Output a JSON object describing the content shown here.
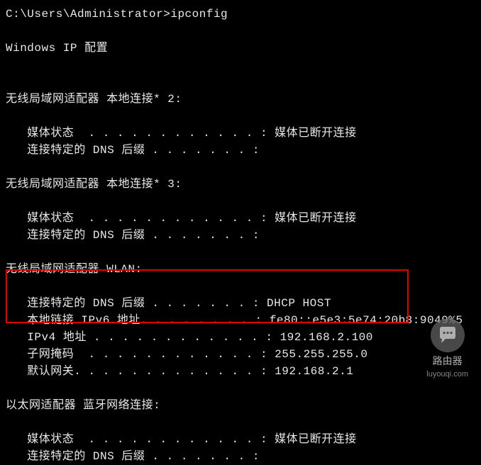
{
  "prompt": "C:\\Users\\Administrator>ipconfig",
  "header": "Windows IP 配置",
  "adapters": {
    "wlan2": {
      "title": "无线局域网适配器 本地连接* 2:",
      "media_state_label": "   媒体状态  . . . . . . . . . . . . : ",
      "media_state_value": "媒体已断开连接",
      "dns_suffix_label": "   连接特定的 DNS 后缀 . . . . . . . :"
    },
    "wlan3": {
      "title": "无线局域网适配器 本地连接* 3:",
      "media_state_label": "   媒体状态  . . . . . . . . . . . . : ",
      "media_state_value": "媒体已断开连接",
      "dns_suffix_label": "   连接特定的 DNS 后缀 . . . . . . . :"
    },
    "wlan": {
      "title": "无线局域网适配器 WLAN:",
      "dns_suffix_label": "   连接特定的 DNS 后缀 . . . . . . . : ",
      "dns_suffix_value": "DHCP HOST",
      "ipv6_label": "   本地链接 IPv6 地址. . . . . . . . : ",
      "ipv6_value": "fe80::e5e3:5e74:20b8:9049%5",
      "ipv4_label": "   IPv4 地址 . . . . . . . . . . . . : ",
      "ipv4_value": "192.168.2.100",
      "subnet_label": "   子网掩码  . . . . . . . . . . . . : ",
      "subnet_value": "255.255.255.0",
      "gateway_label": "   默认网关. . . . . . . . . . . . . : ",
      "gateway_value": "192.168.2.1"
    },
    "bluetooth": {
      "title": "以太网适配器 蓝牙网络连接:",
      "media_state_label": "   媒体状态  . . . . . . . . . . . . : ",
      "media_state_value": "媒体已断开连接",
      "dns_suffix_label": "   连接特定的 DNS 后缀 . . . . . . . :"
    }
  },
  "watermark": {
    "label": "路由器",
    "url": "luyouqi.com"
  }
}
